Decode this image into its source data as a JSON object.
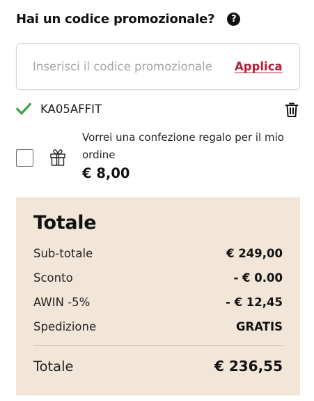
{
  "promo": {
    "title": "Hai un codice promozionale?",
    "help_symbol": "?",
    "input_value": "",
    "input_placeholder": "Inserisci il codice promozionale",
    "apply_label": "Applica",
    "applied_code": "KA05AFFIT"
  },
  "gift": {
    "text": "Vorrei una confezione regalo per il mio ordine",
    "price": "€ 8,00",
    "checked": false
  },
  "summary": {
    "title": "Totale",
    "rows": [
      {
        "label": "Sub-totale",
        "value": "€ 249,00"
      },
      {
        "label": "Sconto",
        "value": "- € 0.00"
      },
      {
        "label": "AWIN -5%",
        "value": "- € 12,45"
      },
      {
        "label": "Spedizione",
        "value": "GRATIS"
      }
    ],
    "total_label": "Totale",
    "total_value": "€ 236,55"
  },
  "colors": {
    "accent": "#b3213b",
    "check": "#4aa04a",
    "summary_bg": "#f2e6d8"
  },
  "icons": {
    "help": "question-circle-icon",
    "check": "check-icon",
    "trash": "trash-icon",
    "gift": "gift-icon"
  }
}
